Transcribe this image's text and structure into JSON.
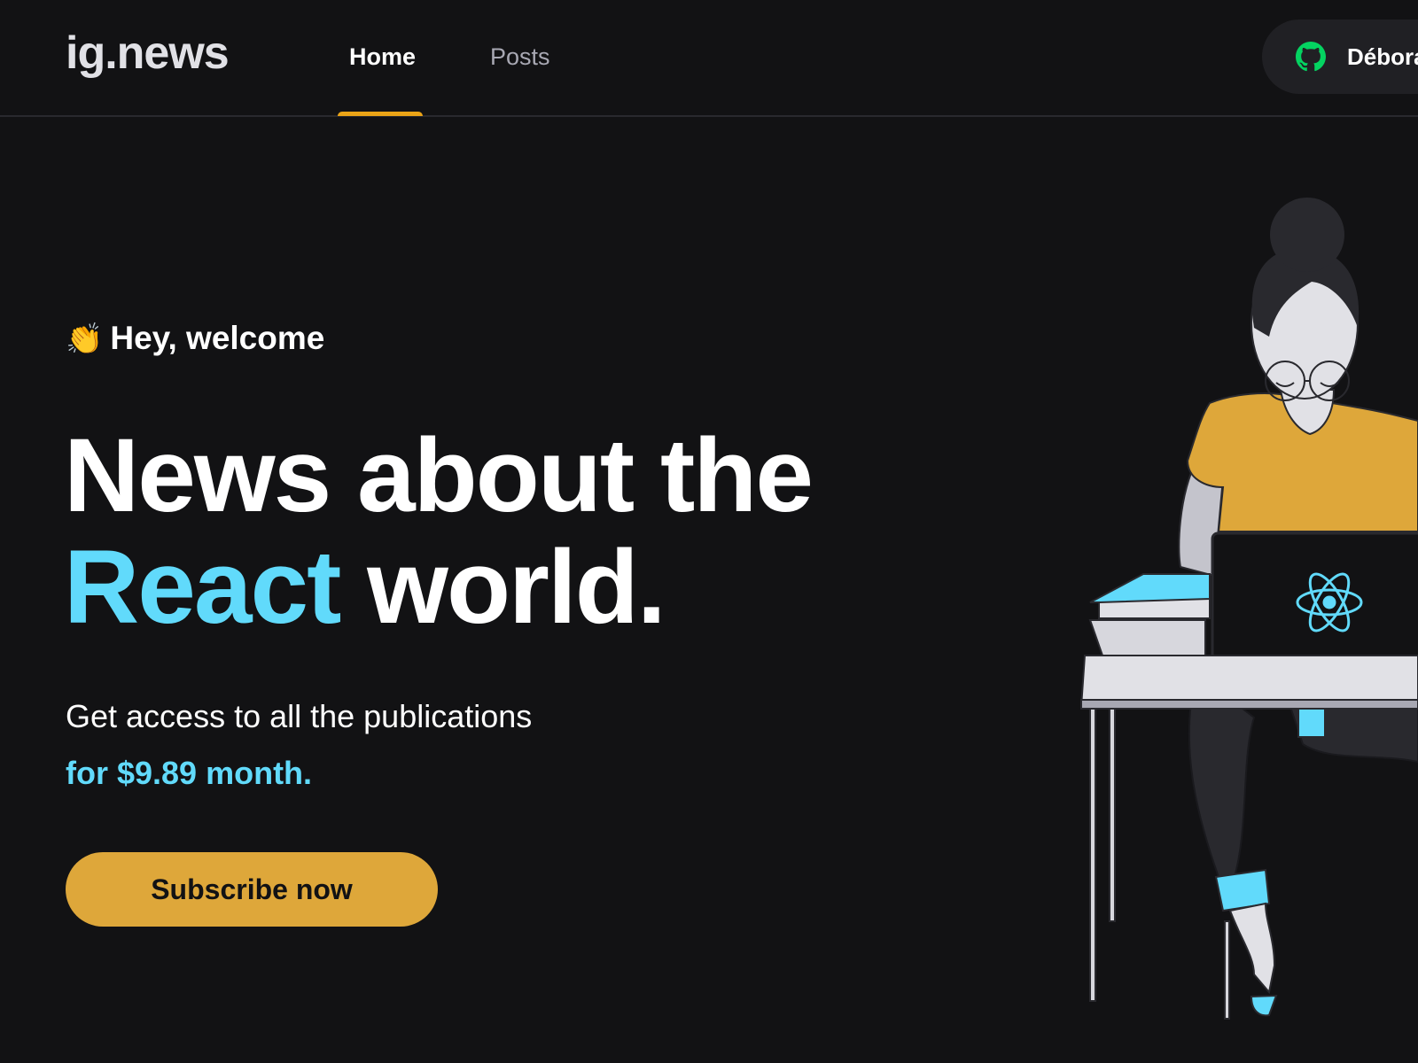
{
  "header": {
    "logo": "ig.news",
    "nav": {
      "home": "Home",
      "posts": "Posts"
    },
    "signin": {
      "name": "Débora",
      "icon": "github-icon"
    }
  },
  "hero": {
    "welcome_emoji": "👏",
    "welcome": "Hey, welcome",
    "headline_line1": "News about the",
    "headline_accent": "React",
    "headline_rest": " world.",
    "subtitle": "Get access to all the publications",
    "price": "for $9.89 month.",
    "subscribe_label": "Subscribe now",
    "illustration": "avatar-illustration"
  },
  "colors": {
    "background": "#121214",
    "accent_yellow": "#eba417",
    "accent_blue": "#61dafb",
    "button": "#dea73a",
    "muted_text": "#a8a8b3",
    "header_border": "#29292e",
    "github_green": "#04d361"
  }
}
